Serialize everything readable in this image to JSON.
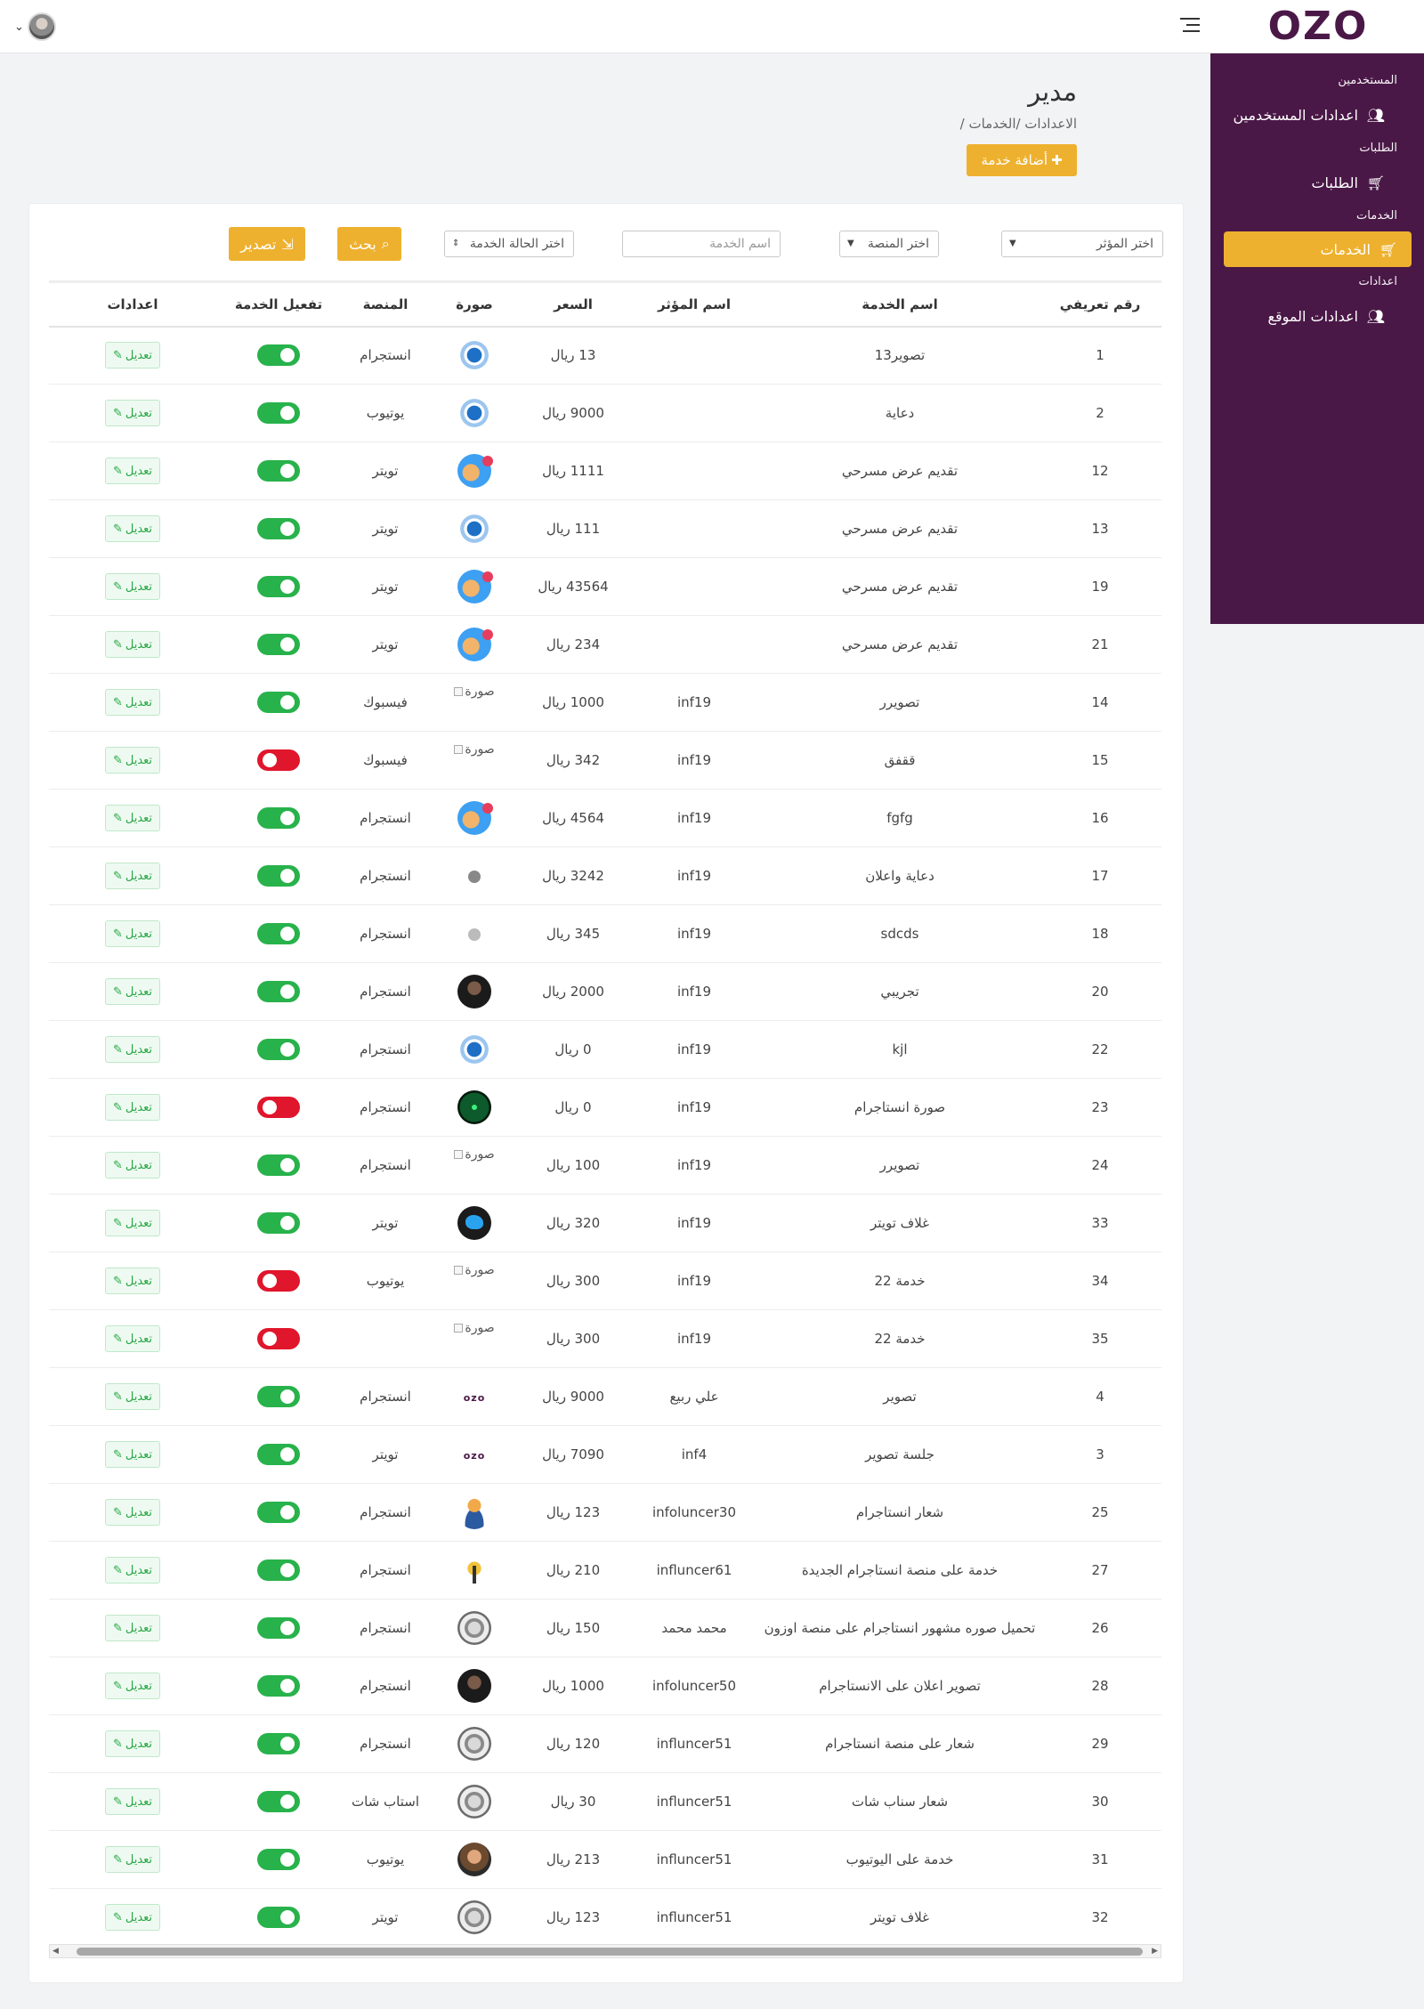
{
  "topbar": {
    "logo_text": "OZO",
    "brand_color": "#4a1847",
    "accent_color": "#eeb12f"
  },
  "sidebar": {
    "sections": [
      {
        "title": "المستخدمين",
        "items": [
          {
            "label": "اعدادات المستخدمين",
            "icon": "users-icon",
            "active": false
          }
        ]
      },
      {
        "title": "الطلبات",
        "items": [
          {
            "label": "الطلبات",
            "icon": "cart-icon",
            "active": false
          }
        ]
      },
      {
        "title": "الخدمات",
        "items": [
          {
            "label": "الخدمات",
            "icon": "cart-icon",
            "active": true
          }
        ]
      },
      {
        "title": "اعدادات",
        "items": [
          {
            "label": "اعدادات الموقع",
            "icon": "users-icon",
            "active": false
          }
        ]
      }
    ]
  },
  "page": {
    "title": "مدير",
    "breadcrumb": "الاعدادات /الخدمات  /",
    "add_button": "أضافة خدمة"
  },
  "filters": {
    "influencer_select": "اختر المؤثر",
    "platform_select": "اختر المنصة",
    "service_name_placeholder": "اسم الخدمة",
    "status_select": "اختر الحالة الخدمة",
    "search_button": "بحث",
    "export_button": "تصدير"
  },
  "table": {
    "headers": [
      "رقم تعريفي",
      "اسم الخدمة",
      "اسم المؤثر",
      "السعر",
      "صورة",
      "المنصة",
      "تفعيل الخدمة",
      "اعدادات"
    ],
    "edit_label": "تعديل",
    "rows": [
      {
        "id": "1",
        "service": "تصوير13",
        "influencer": "",
        "price": "13 ريال",
        "image": "gear",
        "platform": "انستجرام",
        "active": true
      },
      {
        "id": "2",
        "service": "دعاية",
        "influencer": "",
        "price": "9000 ريال",
        "image": "gear",
        "platform": "يوتيوب",
        "active": true
      },
      {
        "id": "12",
        "service": "تقديم عرض مسرحي",
        "influencer": "",
        "price": "1111 ريال",
        "image": "face",
        "platform": "تويتر",
        "active": true
      },
      {
        "id": "13",
        "service": "تقديم عرض مسرحي",
        "influencer": "",
        "price": "111 ريال",
        "image": "gear",
        "platform": "تويتر",
        "active": true
      },
      {
        "id": "19",
        "service": "تقديم عرض مسرحي",
        "influencer": "",
        "price": "43564 ريال",
        "image": "face",
        "platform": "تويتر",
        "active": true
      },
      {
        "id": "21",
        "service": "تقديم عرض مسرحي",
        "influencer": "",
        "price": "234 ريال",
        "image": "face",
        "platform": "تويتر",
        "active": true
      },
      {
        "id": "14",
        "service": "تصويرر",
        "influencer": "inf19",
        "price": "1000 ريال",
        "image": "broken",
        "platform": "فيسبوك",
        "active": true
      },
      {
        "id": "15",
        "service": "ققفق",
        "influencer": "inf19",
        "price": "342 ريال",
        "image": "broken",
        "platform": "فيسبوك",
        "active": false
      },
      {
        "id": "16",
        "service": "fgfg",
        "influencer": "inf19",
        "price": "4564 ريال",
        "image": "face",
        "platform": "انستجرام",
        "active": true
      },
      {
        "id": "17",
        "service": "دعاية واعلان",
        "influencer": "inf19",
        "price": "3242 ريال",
        "image": "small",
        "platform": "انستجرام",
        "active": true
      },
      {
        "id": "18",
        "service": "sdcds",
        "influencer": "inf19",
        "price": "345 ريال",
        "image": "small-dim",
        "platform": "انستجرام",
        "active": true
      },
      {
        "id": "20",
        "service": "تجريبي",
        "influencer": "inf19",
        "price": "2000 ريال",
        "image": "dark",
        "platform": "انستجرام",
        "active": true
      },
      {
        "id": "22",
        "service": "kjl",
        "influencer": "inf19",
        "price": "0 ريال",
        "image": "gear",
        "platform": "انستجرام",
        "active": true
      },
      {
        "id": "23",
        "service": "صورة انستاجرام",
        "influencer": "inf19",
        "price": "0 ريال",
        "image": "green",
        "platform": "انستجرام",
        "active": false
      },
      {
        "id": "24",
        "service": "تصويرر",
        "influencer": "inf19",
        "price": "100 ريال",
        "image": "broken",
        "platform": "انستجرام",
        "active": true
      },
      {
        "id": "33",
        "service": "غلاف تويتر",
        "influencer": "inf19",
        "price": "320 ريال",
        "image": "twitter",
        "platform": "تويتر",
        "active": true
      },
      {
        "id": "34",
        "service": "خدمة 22",
        "influencer": "inf19",
        "price": "300 ريال",
        "image": "broken",
        "platform": "يوتيوب",
        "active": false
      },
      {
        "id": "35",
        "service": "خدمة 22",
        "influencer": "inf19",
        "price": "300 ريال",
        "image": "broken",
        "platform": "",
        "active": false
      },
      {
        "id": "4",
        "service": "تصوير",
        "influencer": "علي ربيع",
        "price": "9000 ريال",
        "image": "logo",
        "platform": "انستجرام",
        "active": true
      },
      {
        "id": "3",
        "service": "جلسة تصوير",
        "influencer": "inf4",
        "price": "7090 ريال",
        "image": "logo",
        "platform": "تويتر",
        "active": true
      },
      {
        "id": "25",
        "service": "شعار انستاجرام",
        "influencer": "infoluncer30",
        "price": "123 ريال",
        "image": "person",
        "platform": "انستجرام",
        "active": true
      },
      {
        "id": "27",
        "service": "خدمة على منصة انستاجرام الجديدة",
        "influencer": "influncer61",
        "price": "210 ريال",
        "image": "star",
        "platform": "انستجرام",
        "active": true
      },
      {
        "id": "26",
        "service": "تحميل صوره مشهور انستاجرام على منصة اوزون",
        "influencer": "محمد محمد",
        "price": "150 ريال",
        "image": "jar",
        "platform": "انستجرام",
        "active": true
      },
      {
        "id": "28",
        "service": "تصوير اعلان على الانستاجرام",
        "influencer": "infoluncer50",
        "price": "1000 ريال",
        "image": "dark",
        "platform": "انستجرام",
        "active": true
      },
      {
        "id": "29",
        "service": "شعار على منصة انستاجرام",
        "influencer": "influncer51",
        "price": "120 ريال",
        "image": "jar",
        "platform": "انستجرام",
        "active": true
      },
      {
        "id": "30",
        "service": "شعار سناب شات",
        "influencer": "influncer51",
        "price": "30 ريال",
        "image": "jar",
        "platform": "استاب شات",
        "active": true
      },
      {
        "id": "31",
        "service": "خدمة على اليوتيوب",
        "influencer": "influncer51",
        "price": "213 ريال",
        "image": "beard",
        "platform": "يوتيوب",
        "active": true
      },
      {
        "id": "32",
        "service": "غلاف تويتر",
        "influencer": "influncer51",
        "price": "123 ريال",
        "image": "jar",
        "platform": "تويتر",
        "active": true
      }
    ],
    "broken_image_alt": "صورة",
    "mini_logo_text": "ozo"
  }
}
